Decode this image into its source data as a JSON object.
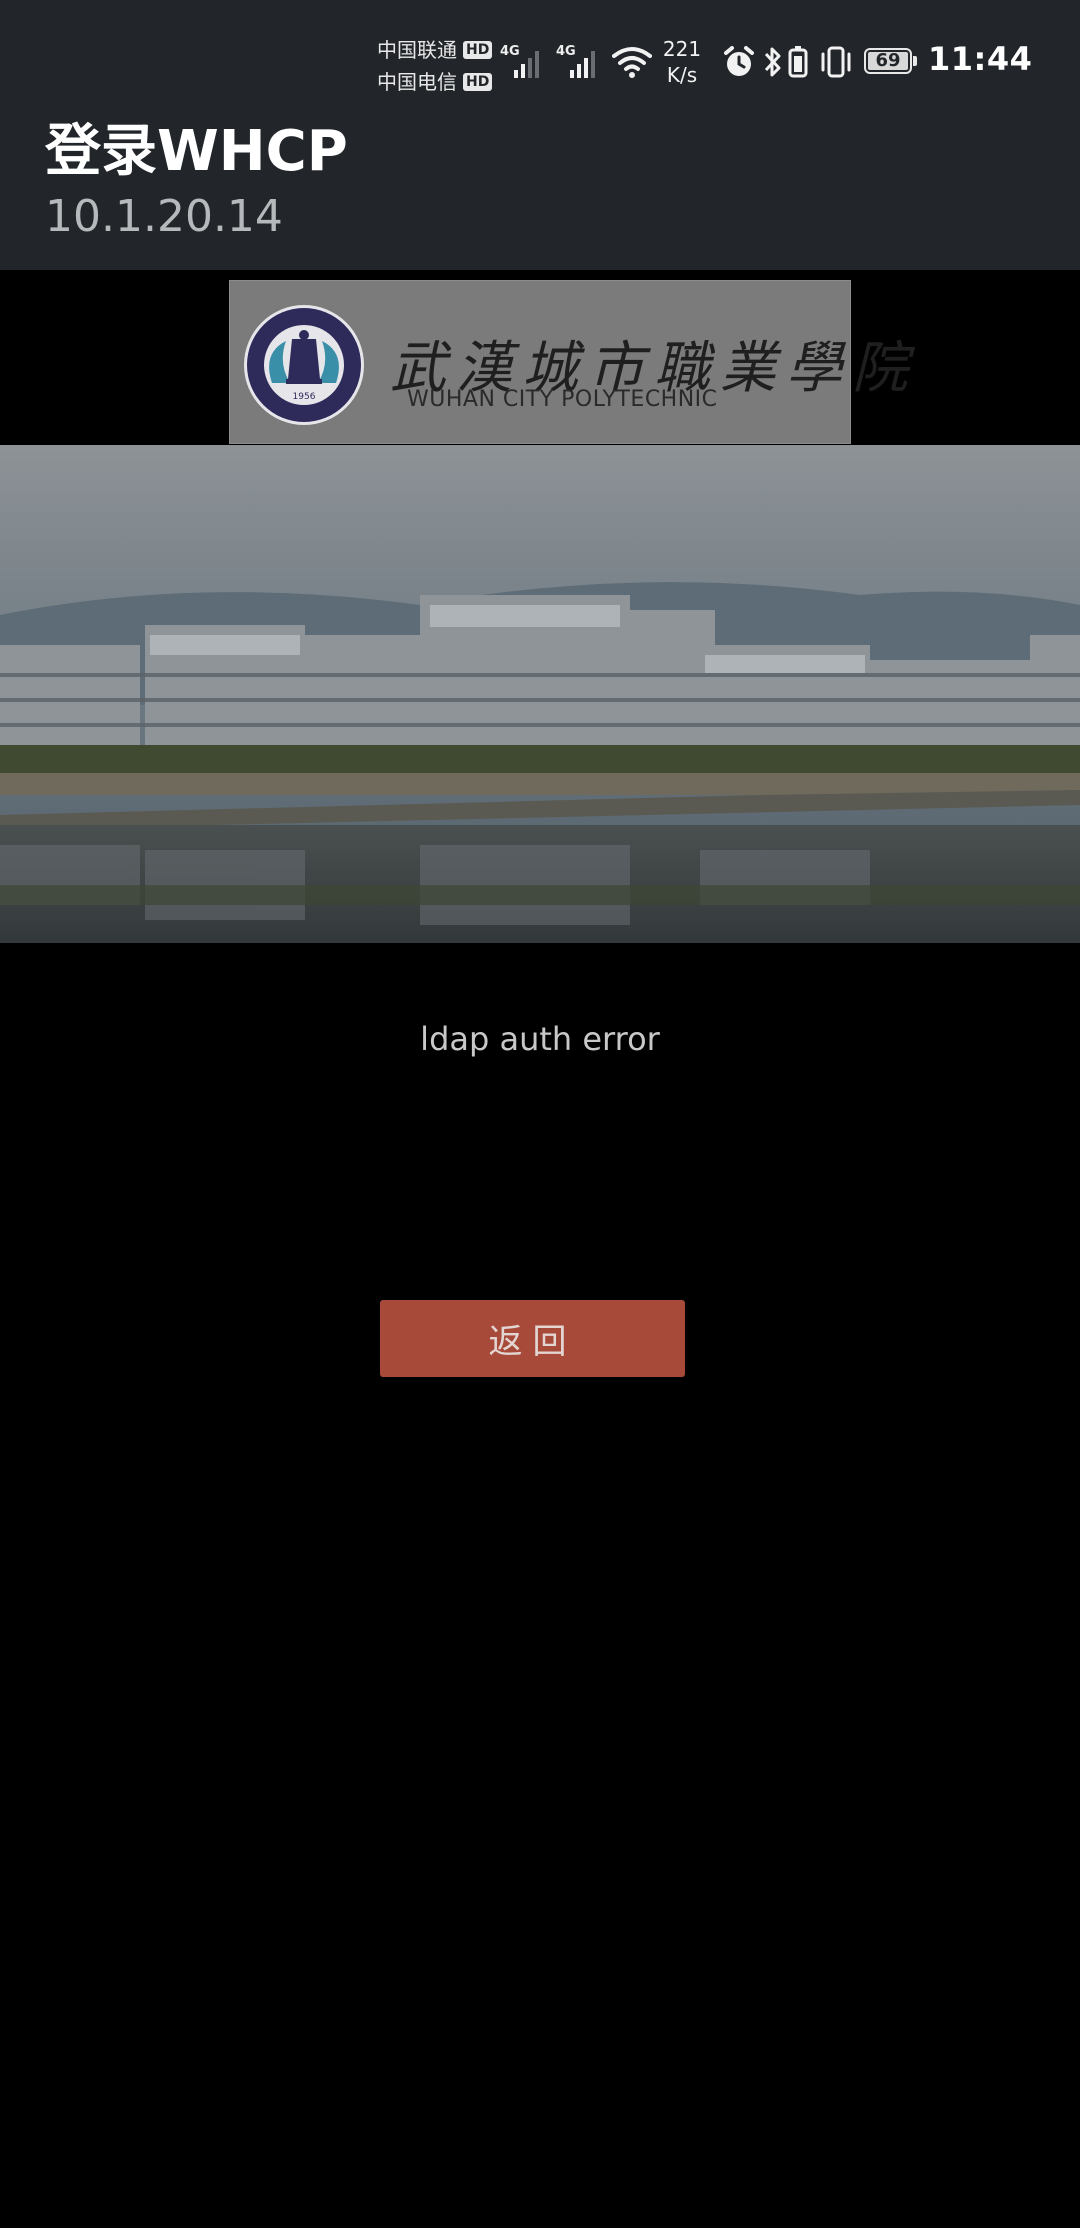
{
  "status_bar": {
    "carrier_1": "中国联通",
    "carrier_2": "中国电信",
    "hd_badge": "HD",
    "network_1": "4G",
    "network_2": "4G",
    "net_speed_value": "221",
    "net_speed_unit": "K/s",
    "battery_level": "69",
    "time": "11:44",
    "icons": [
      "signal-icon",
      "wifi-icon",
      "alarm-icon",
      "bluetooth-icon",
      "vibrate-icon",
      "battery-icon"
    ]
  },
  "header": {
    "title": "登录WHCP",
    "subtitle": "10.1.20.14"
  },
  "banner": {
    "school_name_cn": "武漢城市職業學院",
    "school_name_en": "WUHAN CITY POLYTECHNIC",
    "seal_year": "1956"
  },
  "main": {
    "message": "ldap auth error",
    "back_button_label": "返回"
  },
  "colors": {
    "header_bg": "#22262a",
    "page_bg": "#000000",
    "button_bg": "#a84a3a"
  }
}
